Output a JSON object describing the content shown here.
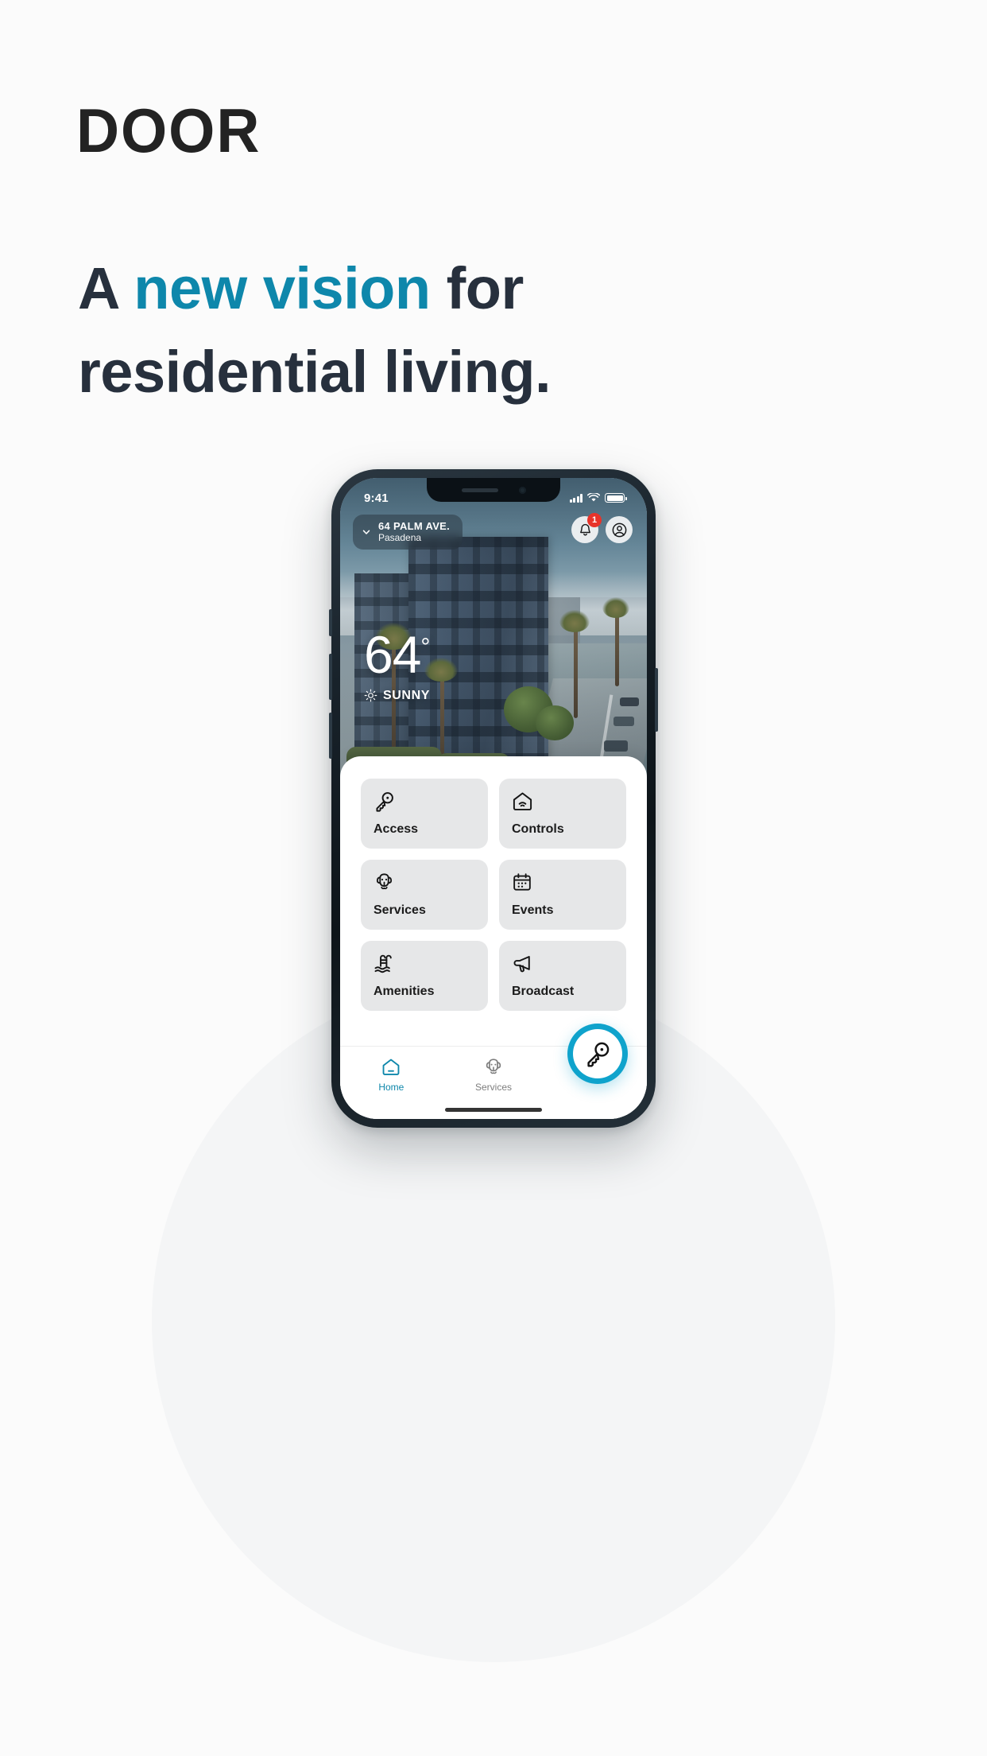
{
  "marketing": {
    "brand": "DOOR",
    "headline_line1_part1": "A ",
    "headline_accent": "new vision",
    "headline_line1_part2": " for",
    "headline_line2": "residential living."
  },
  "colors": {
    "accent_teal": "#0e87ab",
    "fab_teal": "#0fa3cc",
    "headline_dark": "#27303d",
    "brand_dark": "#232323",
    "badge_red": "#e8332a",
    "tile_gray": "#e6e7e8",
    "page_bg": "#fbfbfb"
  },
  "phone": {
    "status_bar": {
      "time": "9:41",
      "signal_icon": "cellular-signal-icon",
      "wifi_icon": "wifi-icon",
      "battery_icon": "battery-icon"
    },
    "header": {
      "address_chevron_icon": "chevron-down-icon",
      "address_line1": "64 PALM AVE.",
      "address_line2": "Pasadena",
      "notifications_icon": "bell-icon",
      "notifications_badge": "1",
      "profile_icon": "user-circle-icon"
    },
    "weather": {
      "temperature": "64",
      "degree_symbol": "°",
      "condition_icon": "sun-icon",
      "condition": "SUNNY"
    },
    "tiles": [
      {
        "label": "Access",
        "icon": "key-icon"
      },
      {
        "label": "Controls",
        "icon": "smart-home-wifi-icon"
      },
      {
        "label": "Services",
        "icon": "dog-icon"
      },
      {
        "label": "Events",
        "icon": "calendar-icon"
      },
      {
        "label": "Amenities",
        "icon": "pool-ladder-icon"
      },
      {
        "label": "Broadcast",
        "icon": "megaphone-icon"
      }
    ],
    "nav": {
      "items": [
        {
          "label": "Home",
          "icon": "home-icon",
          "active": true
        },
        {
          "label": "Services",
          "icon": "dog-icon",
          "active": false
        }
      ],
      "fab_icon": "key-icon"
    }
  }
}
